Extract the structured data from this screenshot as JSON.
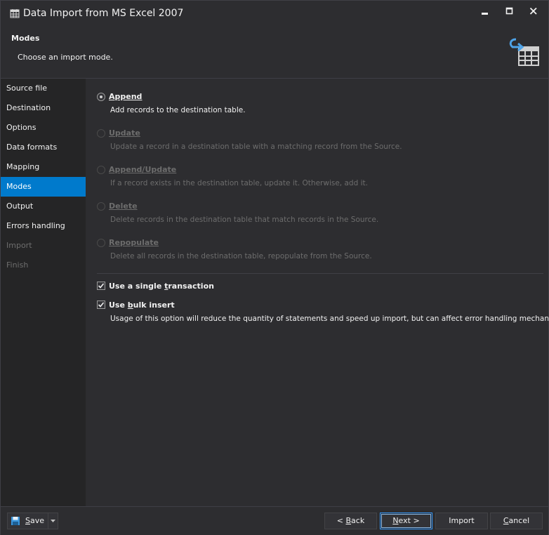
{
  "window": {
    "title": "Data Import from MS Excel 2007"
  },
  "header": {
    "title": "Modes",
    "subtitle": "Choose an import mode."
  },
  "sidebar": {
    "items": [
      {
        "label": "Source file",
        "state": "normal"
      },
      {
        "label": "Destination",
        "state": "normal"
      },
      {
        "label": "Options",
        "state": "normal"
      },
      {
        "label": "Data formats",
        "state": "normal"
      },
      {
        "label": "Mapping",
        "state": "normal"
      },
      {
        "label": "Modes",
        "state": "active"
      },
      {
        "label": "Output",
        "state": "normal"
      },
      {
        "label": "Errors handling",
        "state": "normal"
      },
      {
        "label": "Import",
        "state": "disabled"
      },
      {
        "label": "Finish",
        "state": "disabled"
      }
    ]
  },
  "modes": [
    {
      "label": "Append",
      "desc": "Add records to the destination table.",
      "checked": true,
      "enabled": true
    },
    {
      "label": "Update",
      "desc": "Update a record in a destination table with a matching record from the Source.",
      "checked": false,
      "enabled": false
    },
    {
      "label": "Append/Update",
      "desc": "If a record exists in the destination table, update it. Otherwise, add it.",
      "checked": false,
      "enabled": false
    },
    {
      "label": "Delete",
      "desc": "Delete records in the destination table that match records in the Source.",
      "checked": false,
      "enabled": false
    },
    {
      "label": "Repopulate",
      "desc": "Delete all records in the destination table, repopulate from the Source.",
      "checked": false,
      "enabled": false
    }
  ],
  "options": {
    "single_transaction": {
      "label_pre": "Use a single ",
      "label_u": "t",
      "label_post": "ransaction",
      "checked": true
    },
    "bulk_insert": {
      "label_pre": "Use ",
      "label_u": "b",
      "label_post": "ulk insert",
      "checked": true,
      "desc": "Usage of this option will reduce the quantity of statements and speed up import, but can affect error handling mechanism."
    }
  },
  "footer": {
    "save": {
      "u": "S",
      "rest": "ave"
    },
    "back": {
      "pre": "< ",
      "u": "B",
      "rest": "ack"
    },
    "next": {
      "u": "N",
      "rest": "ext >"
    },
    "import": "Import",
    "cancel": {
      "u": "C",
      "rest": "ancel"
    }
  },
  "colors": {
    "accent": "#007acc",
    "background": "#2d2d30",
    "sidebar": "#252526",
    "disabled_text": "#6d6d6d"
  },
  "icons": {
    "app": "calendar-table-icon",
    "header": "import-table-icon",
    "save": "floppy-disk-icon"
  }
}
